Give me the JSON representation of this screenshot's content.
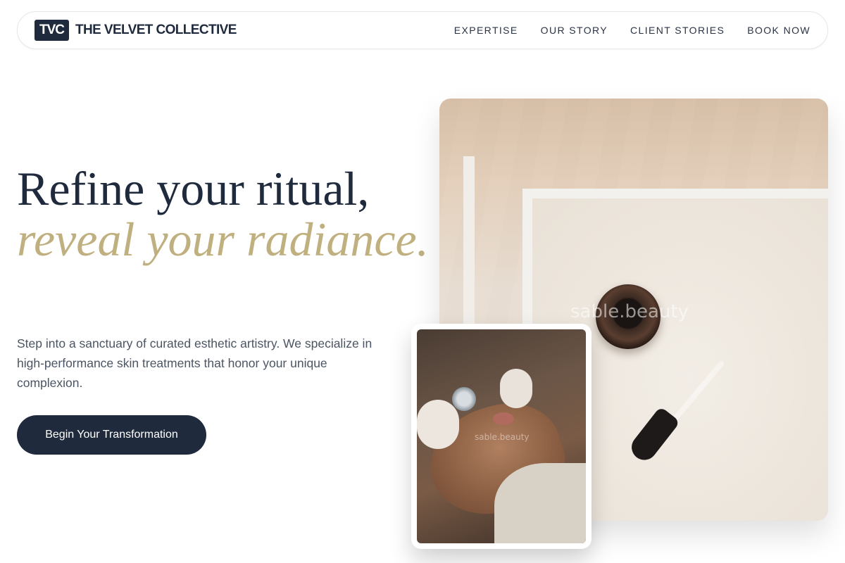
{
  "nav": {
    "logo_mark": "TVC",
    "brand_name": "THE VELVET COLLECTIVE",
    "links": [
      "EXPERTISE",
      "OUR STORY",
      "CLIENT STORIES",
      "BOOK NOW"
    ]
  },
  "hero": {
    "title_line1": "Refine your ritual,",
    "title_line2": "reveal your radiance.",
    "description": "Step into a sanctuary of curated esthetic artistry. We specialize in high-performance skin treatments that honor your unique complexion.",
    "cta_label": "Begin Your Transformation"
  },
  "images": {
    "main_watermark": "sable.beauty",
    "secondary_watermark": "sable.beauty"
  },
  "colors": {
    "navy": "#1f2a3d",
    "gold": "#c0b080",
    "text_muted": "#4b5563"
  }
}
